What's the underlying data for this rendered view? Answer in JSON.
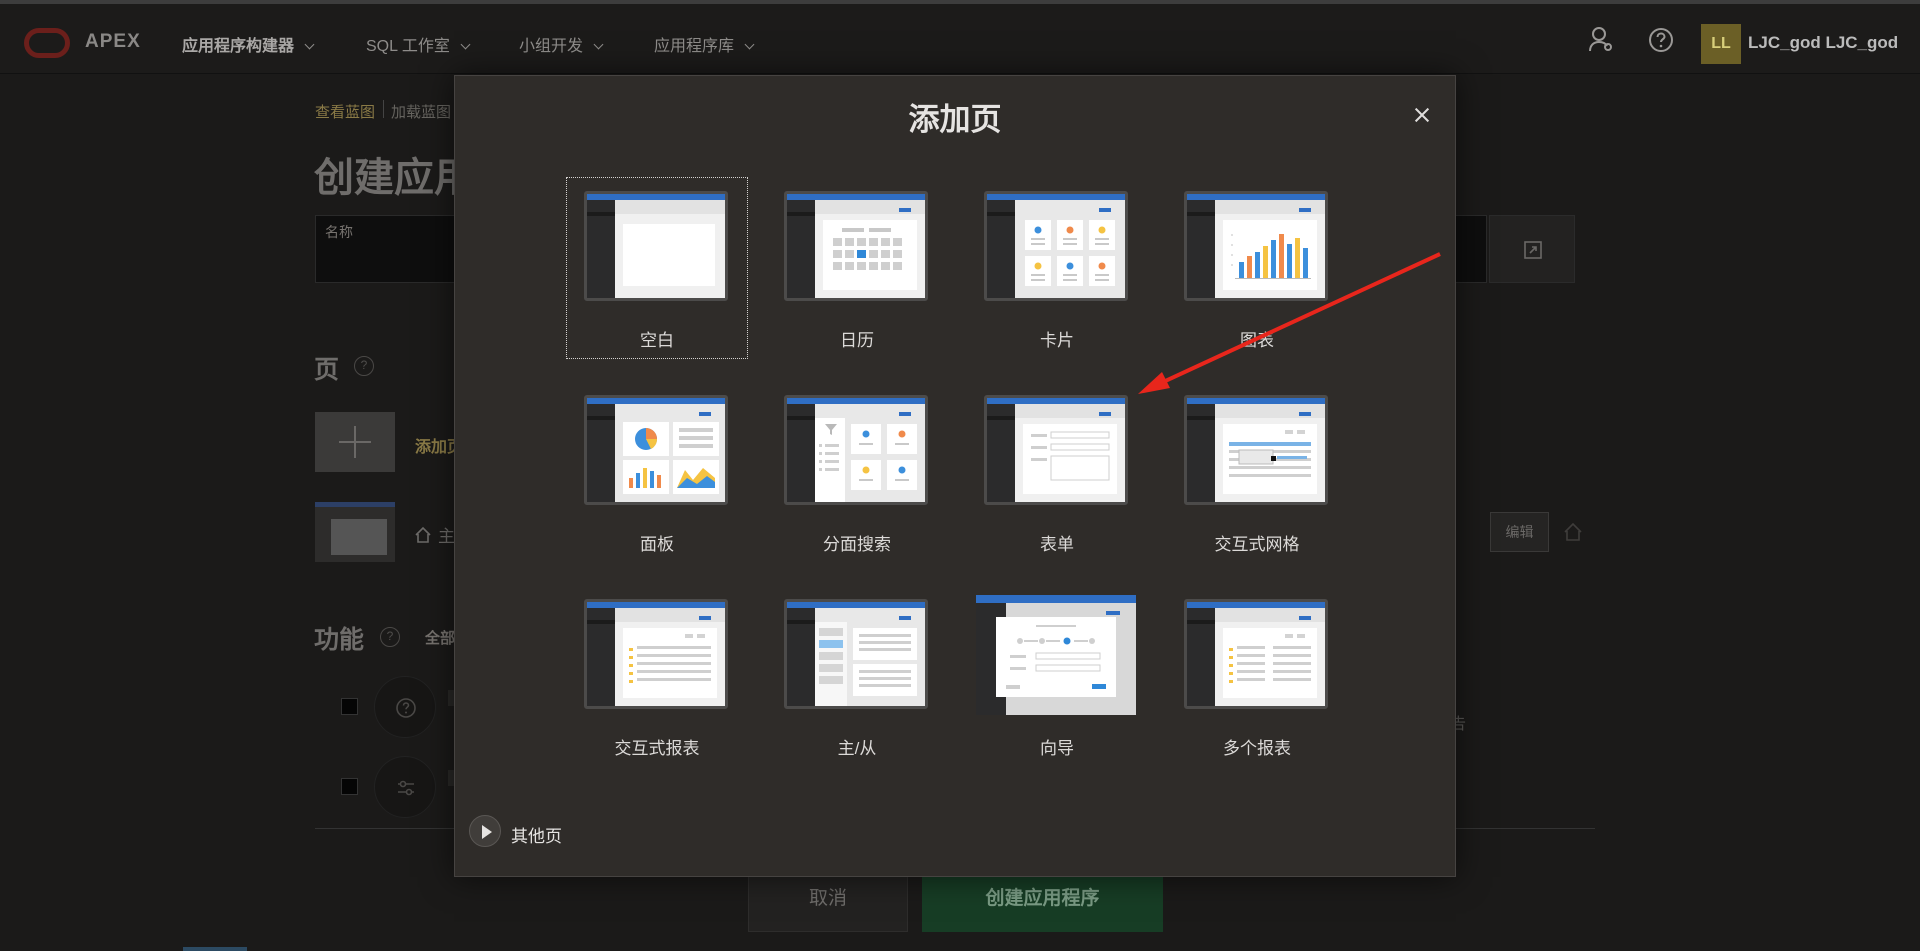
{
  "topbar": {
    "brand": "APEX",
    "nav": [
      {
        "label": "应用程序构建器"
      },
      {
        "label": "SQL 工作室"
      },
      {
        "label": "小组开发"
      },
      {
        "label": "应用程序库"
      }
    ],
    "avatar_initials": "LL",
    "username": "LJC_god LJC_god"
  },
  "background_page": {
    "breadcrumb": [
      "查看蓝图",
      "加载蓝图"
    ],
    "heading": "创建应用",
    "name_field_label": "名称",
    "pages_section_title": "页",
    "add_page_label": "添加页",
    "home_page_label": "主",
    "edit_label": "编辑",
    "features_section_title": "功能",
    "features_filter_label": "全部",
    "features_right_hint": "告",
    "cancel_label": "取消",
    "create_label": "创建应用程序"
  },
  "modal": {
    "title": "添加页",
    "close_icon": "close-icon",
    "tiles": [
      {
        "label": "空白",
        "icon": "blank-page-icon",
        "selected": true
      },
      {
        "label": "日历",
        "icon": "calendar-icon"
      },
      {
        "label": "卡片",
        "icon": "cards-icon"
      },
      {
        "label": "图表",
        "icon": "chart-icon"
      },
      {
        "label": "面板",
        "icon": "dashboard-icon"
      },
      {
        "label": "分面搜索",
        "icon": "faceted-search-icon"
      },
      {
        "label": "表单",
        "icon": "form-icon"
      },
      {
        "label": "交互式网格",
        "icon": "interactive-grid-icon"
      },
      {
        "label": "交互式报表",
        "icon": "interactive-report-icon"
      },
      {
        "label": "主/从",
        "icon": "master-detail-icon"
      },
      {
        "label": "向导",
        "icon": "wizard-icon"
      },
      {
        "label": "多个报表",
        "icon": "multiple-reports-icon"
      }
    ],
    "more_pages_label": "其他页"
  },
  "colors": {
    "accent_blue": "#2f6ec4",
    "annotation_arrow": "#e8261c",
    "modal_bg": "#2f2c29",
    "create_button": "#173d25"
  }
}
